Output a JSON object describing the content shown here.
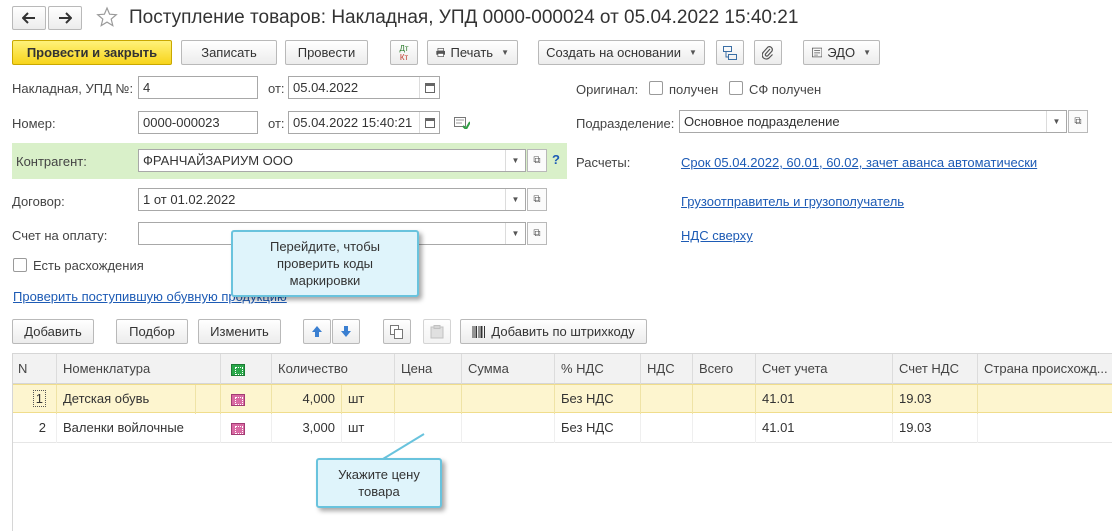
{
  "window": {
    "title": "Поступление товаров: Накладная, УПД 0000-000024 от 05.04.2022 15:40:21",
    "back_icon": "arrow-left",
    "forward_icon": "arrow-right",
    "star_icon": "star-outline"
  },
  "toolbar": {
    "post_close": "Провести и закрыть",
    "save": "Записать",
    "post": "Провести",
    "dtkt_top": "Дт",
    "dtkt_bottom": "Кт",
    "print": "Печать",
    "create_based": "Создать на основании",
    "edo": "ЭДО"
  },
  "form": {
    "invoice_label": "Накладная, УПД №:",
    "invoice_value": "4",
    "from_label": "от:",
    "invoice_date": "05.04.2022",
    "number_label": "Номер:",
    "number_value": "0000-000023",
    "from2_label": "от:",
    "number_date": "05.04.2022 15:40:21",
    "contractor_label": "Контрагент:",
    "contractor_value": "ФРАНЧАЙЗАРИУМ ООО",
    "help": "?",
    "contract_label": "Договор:",
    "contract_value": "1 от 01.02.2022",
    "payment_label": "Счет на оплату:",
    "payment_value": "",
    "discrepancy_label": "Есть расхождения",
    "check_link": "Проверить поступившую обувную продукцию"
  },
  "right_panel": {
    "original_label": "Оригинал:",
    "received_label": "получен",
    "sf_received_label": "СФ получен",
    "division_label": "Подразделение:",
    "division_value": "Основное подразделение",
    "settlements_label": "Расчеты:",
    "settlements_link": "Срок 05.04.2022, 60.01, 60.02, зачет аванса автоматически",
    "shipper_link": "Грузоотправитель и грузополучатель",
    "vat_link": "НДС сверху"
  },
  "table_toolbar": {
    "add": "Добавить",
    "select": "Подбор",
    "edit": "Изменить",
    "add_barcode": "Добавить по штрихкоду"
  },
  "table": {
    "columns": [
      "N",
      "Номенклатура",
      "",
      "Количество",
      "Цена",
      "Сумма",
      "% НДС",
      "НДС",
      "Всего",
      "Счет учета",
      "Счет НДС",
      "Страна происхожд..."
    ],
    "rows": [
      {
        "n": "1",
        "name": "Детская обувь",
        "qty": "4,000",
        "unit": "шт",
        "price": "",
        "sum": "",
        "vat_rate": "Без НДС",
        "vat": "",
        "total": "",
        "account": "41.01",
        "vat_account": "19.03",
        "country": ""
      },
      {
        "n": "2",
        "name": "Валенки войлочные",
        "qty": "3,000",
        "unit": "шт",
        "price": "",
        "sum": "",
        "vat_rate": "Без НДС",
        "vat": "",
        "total": "",
        "account": "41.01",
        "vat_account": "19.03",
        "country": ""
      }
    ]
  },
  "tooltips": {
    "check_marking": "Перейдите, чтобы проверить коды маркировки",
    "enter_price": "Укажите цену товара"
  },
  "colors": {
    "primary_button": "#f7d41b",
    "link": "#1d5bb5",
    "contractor_highlight": "#d9f0c9",
    "selected_row": "#fdf5cf",
    "tooltip_bg": "#dff4fb",
    "tooltip_border": "#69c3dd"
  }
}
